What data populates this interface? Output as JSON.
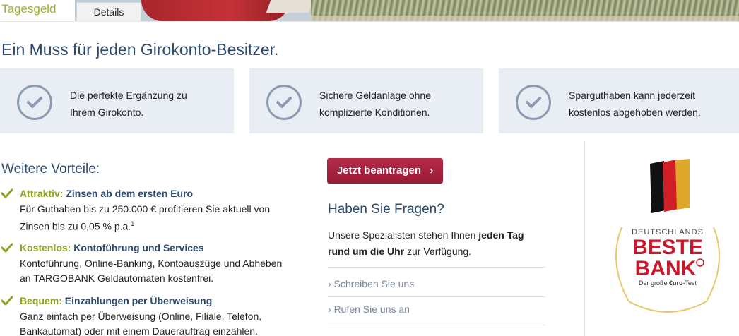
{
  "tabs": {
    "active": "Tagesgeld",
    "details": "Details"
  },
  "headline": "Ein Muss für jeden Girokonto-Besitzer.",
  "features": [
    {
      "line1": "Die perfekte Ergänzung zu",
      "line2": "Ihrem Girokonto."
    },
    {
      "line1": "Sichere Geldanlage ohne",
      "line2": "komplizierte Konditionen."
    },
    {
      "line1": "Sparguthaben kann jederzeit",
      "line2": "kostenlos abgehoben werden."
    }
  ],
  "advantages_title": "Weitere Vorteile:",
  "advantages": [
    {
      "label": "Attraktiv:",
      "title": "Zinsen ab dem ersten Euro",
      "desc1": "Für Guthaben bis zu 250.000 € profitieren Sie aktuell von",
      "desc2": "Zinsen bis zu 0,05 % p.a.",
      "footnote": "1"
    },
    {
      "label": "Kostenlos:",
      "title": "Kontoführung und Services",
      "desc1": "Kontoführung, Online-Banking, Kontoauszüge und Abheben",
      "desc2": "an TARGOBANK Geldautomaten kostenfrei."
    },
    {
      "label": "Bequem:",
      "title": "Einzahlungen per Überweisung",
      "desc1": "Ganz einfach per Überweisung (Online, Filiale, Telefon,",
      "desc2": "Bankautomat) oder mit einem Dauerauftrag einzahlen."
    }
  ],
  "apply_button": "Jetzt beantragen",
  "questions": {
    "title": "Haben Sie Fragen?",
    "text_a": "Unsere Spezialisten stehen Ihnen ",
    "text_b": "jeden Tag",
    "text_c": "rund um die Uhr",
    "text_d": " zur Verfügung.",
    "link1": "Schreiben Sie uns",
    "link2": "Rufen Sie uns an"
  },
  "badge": {
    "top": "DEUTSCHLANDS",
    "line1": "BESTE",
    "line2": "BANK",
    "bottom_a": "Der große ",
    "bottom_b": "€uro",
    "bottom_c": "-Test"
  },
  "colors": {
    "accent_green": "#8aa61e",
    "heading_blue": "#2c4a6e",
    "button_red": "#a8213d",
    "box_bg": "#e9eef4"
  }
}
